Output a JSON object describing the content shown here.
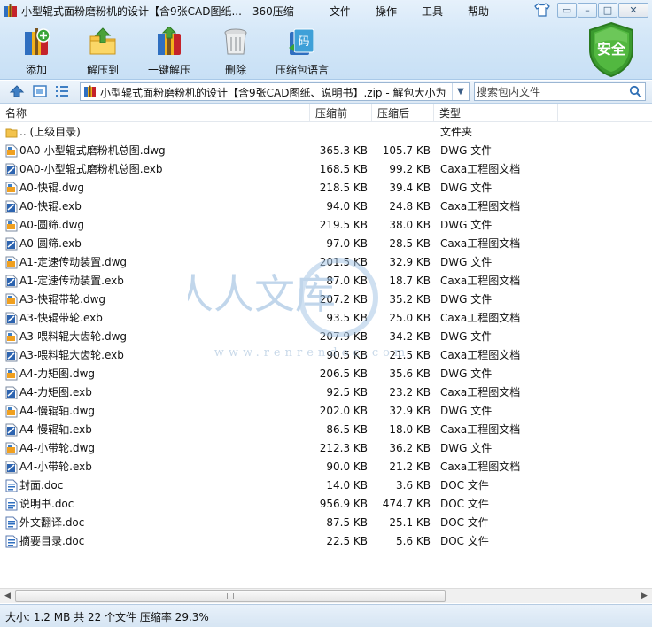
{
  "window": {
    "title": "小型辊式面粉磨粉机的设计【含9张CAD图纸... - 360压缩",
    "menu": [
      "文件",
      "操作",
      "工具",
      "帮助"
    ],
    "controls": {
      "minimize": "–",
      "maximize": "□",
      "close": "✕"
    }
  },
  "toolbar": {
    "items": [
      {
        "label": "添加",
        "icon": "add-archive-icon"
      },
      {
        "label": "解压到",
        "icon": "extract-to-icon"
      },
      {
        "label": "一键解压",
        "icon": "one-click-extract-icon"
      },
      {
        "label": "删除",
        "icon": "delete-trash-icon"
      },
      {
        "label": "压缩包语言",
        "icon": "archive-language-icon"
      }
    ],
    "language_icon_glyph": "码",
    "safe_badge": "安全"
  },
  "address": {
    "path": "小型辊式面粉磨粉机的设计【含9张CAD图纸、说明书】.zip - 解包大小为",
    "search_placeholder": "搜索包内文件"
  },
  "columns": {
    "name": "名称",
    "size": "压缩前",
    "compressed": "压缩后",
    "type": "类型"
  },
  "files": [
    {
      "name": ".. (上级目录)",
      "size": "",
      "compressed": "",
      "type": "文件夹",
      "icon": "folder"
    },
    {
      "name": "0A0-小型辊式磨粉机总图.dwg",
      "size": "365.3 KB",
      "compressed": "105.7 KB",
      "type": "DWG 文件",
      "icon": "dwg"
    },
    {
      "name": "0A0-小型辊式磨粉机总图.exb",
      "size": "168.5 KB",
      "compressed": "99.2 KB",
      "type": "Caxa工程图文档",
      "icon": "exb"
    },
    {
      "name": "A0-快辊.dwg",
      "size": "218.5 KB",
      "compressed": "39.4 KB",
      "type": "DWG 文件",
      "icon": "dwg"
    },
    {
      "name": "A0-快辊.exb",
      "size": "94.0 KB",
      "compressed": "24.8 KB",
      "type": "Caxa工程图文档",
      "icon": "exb"
    },
    {
      "name": "A0-圆筛.dwg",
      "size": "219.5 KB",
      "compressed": "38.0 KB",
      "type": "DWG 文件",
      "icon": "dwg"
    },
    {
      "name": "A0-圆筛.exb",
      "size": "97.0 KB",
      "compressed": "28.5 KB",
      "type": "Caxa工程图文档",
      "icon": "exb"
    },
    {
      "name": "A1-定速传动装置.dwg",
      "size": "201.5 KB",
      "compressed": "32.9 KB",
      "type": "DWG 文件",
      "icon": "dwg"
    },
    {
      "name": "A1-定速传动装置.exb",
      "size": "87.0 KB",
      "compressed": "18.7 KB",
      "type": "Caxa工程图文档",
      "icon": "exb"
    },
    {
      "name": "A3-快辊带轮.dwg",
      "size": "207.2 KB",
      "compressed": "35.2 KB",
      "type": "DWG 文件",
      "icon": "dwg"
    },
    {
      "name": "A3-快辊带轮.exb",
      "size": "93.5 KB",
      "compressed": "25.0 KB",
      "type": "Caxa工程图文档",
      "icon": "exb"
    },
    {
      "name": "A3-喂料辊大齿轮.dwg",
      "size": "207.9 KB",
      "compressed": "34.2 KB",
      "type": "DWG 文件",
      "icon": "dwg"
    },
    {
      "name": "A3-喂料辊大齿轮.exb",
      "size": "90.5 KB",
      "compressed": "21.5 KB",
      "type": "Caxa工程图文档",
      "icon": "exb"
    },
    {
      "name": "A4-力矩图.dwg",
      "size": "206.5 KB",
      "compressed": "35.6 KB",
      "type": "DWG 文件",
      "icon": "dwg"
    },
    {
      "name": "A4-力矩图.exb",
      "size": "92.5 KB",
      "compressed": "23.2 KB",
      "type": "Caxa工程图文档",
      "icon": "exb"
    },
    {
      "name": "A4-慢辊轴.dwg",
      "size": "202.0 KB",
      "compressed": "32.9 KB",
      "type": "DWG 文件",
      "icon": "dwg"
    },
    {
      "name": "A4-慢辊轴.exb",
      "size": "86.5 KB",
      "compressed": "18.0 KB",
      "type": "Caxa工程图文档",
      "icon": "exb"
    },
    {
      "name": "A4-小带轮.dwg",
      "size": "212.3 KB",
      "compressed": "36.2 KB",
      "type": "DWG 文件",
      "icon": "dwg"
    },
    {
      "name": "A4-小带轮.exb",
      "size": "90.0 KB",
      "compressed": "21.2 KB",
      "type": "Caxa工程图文档",
      "icon": "exb"
    },
    {
      "name": "封面.doc",
      "size": "14.0 KB",
      "compressed": "3.6 KB",
      "type": "DOC 文件",
      "icon": "doc"
    },
    {
      "name": "说明书.doc",
      "size": "956.9 KB",
      "compressed": "474.7 KB",
      "type": "DOC 文件",
      "icon": "doc"
    },
    {
      "name": "外文翻译.doc",
      "size": "87.5 KB",
      "compressed": "25.1 KB",
      "type": "DOC 文件",
      "icon": "doc"
    },
    {
      "name": "摘要目录.doc",
      "size": "22.5 KB",
      "compressed": "5.6 KB",
      "type": "DOC 文件",
      "icon": "doc"
    }
  ],
  "watermark": {
    "text": "人人文库",
    "url": "www.renrendoc.com"
  },
  "status": "大小: 1.2 MB 共 22 个文件 压缩率 29.3%",
  "colors": {
    "accent": "#3f7fc4",
    "safe_green": "#3a9a2e",
    "watermark_blue": "#8fb6dc"
  }
}
